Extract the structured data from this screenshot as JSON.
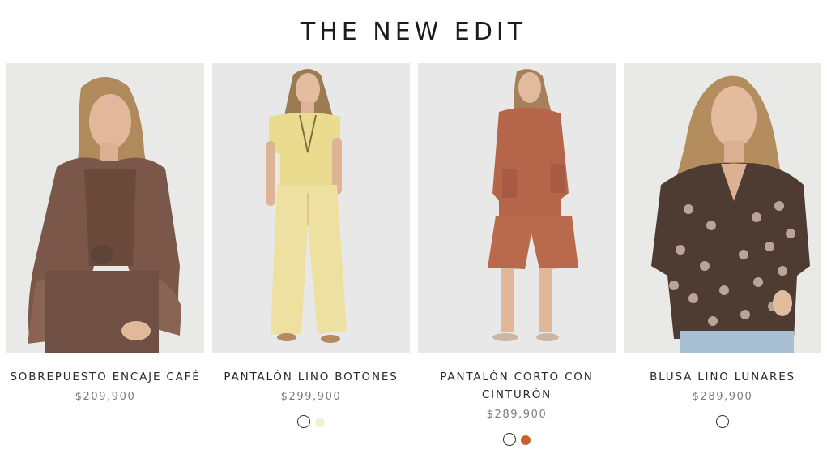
{
  "section": {
    "title": "THE NEW EDIT"
  },
  "products": [
    {
      "name": "SOBREPUESTO ENCAJE CAFÉ",
      "price": "$209,900",
      "swatches": []
    },
    {
      "name": "PANTALÓN LINO BOTONES",
      "price": "$299,900",
      "swatches": [
        "#ffffff",
        "#f3f0d2"
      ]
    },
    {
      "name": "PANTALÓN CORTO CON CINTURÓN",
      "price": "$289,900",
      "swatches": [
        "#ffffff",
        "#c4622a"
      ]
    },
    {
      "name": "BLUSA LINO LUNARES",
      "price": "$289,900",
      "swatches": [
        "#ffffff"
      ]
    }
  ],
  "colors": {
    "accent_rust": "#c4622a",
    "cream": "#f3f0d2",
    "text_dark": "#1c1c1c",
    "price_gray": "#7a7a7a"
  }
}
